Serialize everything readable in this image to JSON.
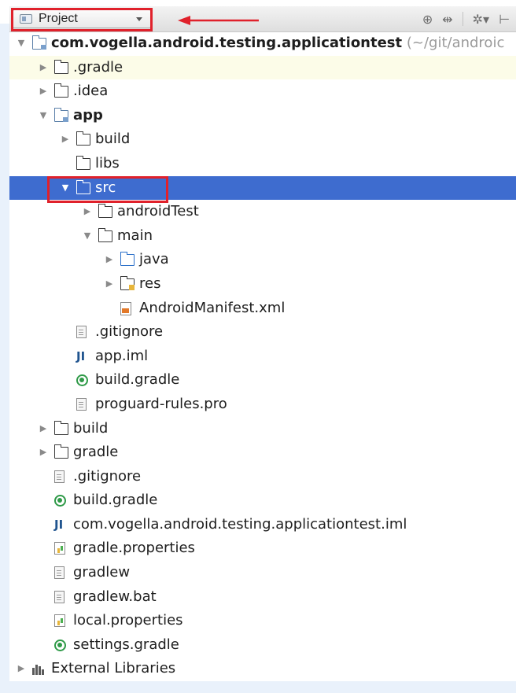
{
  "toolbar": {
    "view_selector": "Project",
    "icons": [
      "sync-icon",
      "collapse-icon",
      "settings-icon",
      "hide-icon"
    ]
  },
  "colors": {
    "selection": "#3e6ccf",
    "annotation_red": "#e0212b",
    "hover_yellow": "#fcfce8"
  },
  "tree": {
    "items": [
      {
        "label": "com.vogella.android.testing.applicationtest",
        "path": "(~/git/androic",
        "icon": "module-folder-icon",
        "depth": 0,
        "expand": "open"
      },
      {
        "label": ".gradle",
        "icon": "folder-icon",
        "depth": 1,
        "expand": "closed"
      },
      {
        "label": ".idea",
        "icon": "folder-icon",
        "depth": 1,
        "expand": "closed"
      },
      {
        "label": "app",
        "icon": "module-folder-icon",
        "depth": 1,
        "expand": "open"
      },
      {
        "label": "build",
        "icon": "folder-icon",
        "depth": 2,
        "expand": "closed"
      },
      {
        "label": "libs",
        "icon": "folder-icon",
        "depth": 2,
        "expand": "none"
      },
      {
        "label": "src",
        "icon": "folder-icon",
        "depth": 2,
        "expand": "open"
      },
      {
        "label": "androidTest",
        "icon": "folder-icon",
        "depth": 3,
        "expand": "closed"
      },
      {
        "label": "main",
        "icon": "folder-icon",
        "depth": 3,
        "expand": "open"
      },
      {
        "label": "java",
        "icon": "source-folder-icon",
        "depth": 4,
        "expand": "closed"
      },
      {
        "label": "res",
        "icon": "resource-folder-icon",
        "depth": 4,
        "expand": "closed"
      },
      {
        "label": "AndroidManifest.xml",
        "icon": "xml-file-icon",
        "depth": 4,
        "expand": "none"
      },
      {
        "label": ".gitignore",
        "icon": "text-file-icon",
        "depth": 2,
        "expand": "none"
      },
      {
        "label": "app.iml",
        "icon": "iml-file-icon",
        "depth": 2,
        "expand": "none"
      },
      {
        "label": "build.gradle",
        "icon": "gradle-file-icon",
        "depth": 2,
        "expand": "none"
      },
      {
        "label": "proguard-rules.pro",
        "icon": "text-file-icon",
        "depth": 2,
        "expand": "none"
      },
      {
        "label": "build",
        "icon": "folder-icon",
        "depth": 1,
        "expand": "closed"
      },
      {
        "label": "gradle",
        "icon": "folder-icon",
        "depth": 1,
        "expand": "closed"
      },
      {
        "label": ".gitignore",
        "icon": "text-file-icon",
        "depth": 1,
        "expand": "none"
      },
      {
        "label": "build.gradle",
        "icon": "gradle-file-icon",
        "depth": 1,
        "expand": "none"
      },
      {
        "label": "com.vogella.android.testing.applicationtest.iml",
        "icon": "iml-file-icon",
        "depth": 1,
        "expand": "none"
      },
      {
        "label": "gradle.properties",
        "icon": "properties-file-icon",
        "depth": 1,
        "expand": "none"
      },
      {
        "label": "gradlew",
        "icon": "text-file-icon",
        "depth": 1,
        "expand": "none"
      },
      {
        "label": "gradlew.bat",
        "icon": "text-file-icon",
        "depth": 1,
        "expand": "none"
      },
      {
        "label": "local.properties",
        "icon": "properties-file-icon",
        "depth": 1,
        "expand": "none"
      },
      {
        "label": "settings.gradle",
        "icon": "gradle-file-icon",
        "depth": 1,
        "expand": "none"
      },
      {
        "label": "External Libraries",
        "icon": "libraries-icon",
        "depth": 0,
        "expand": "closed"
      }
    ]
  }
}
